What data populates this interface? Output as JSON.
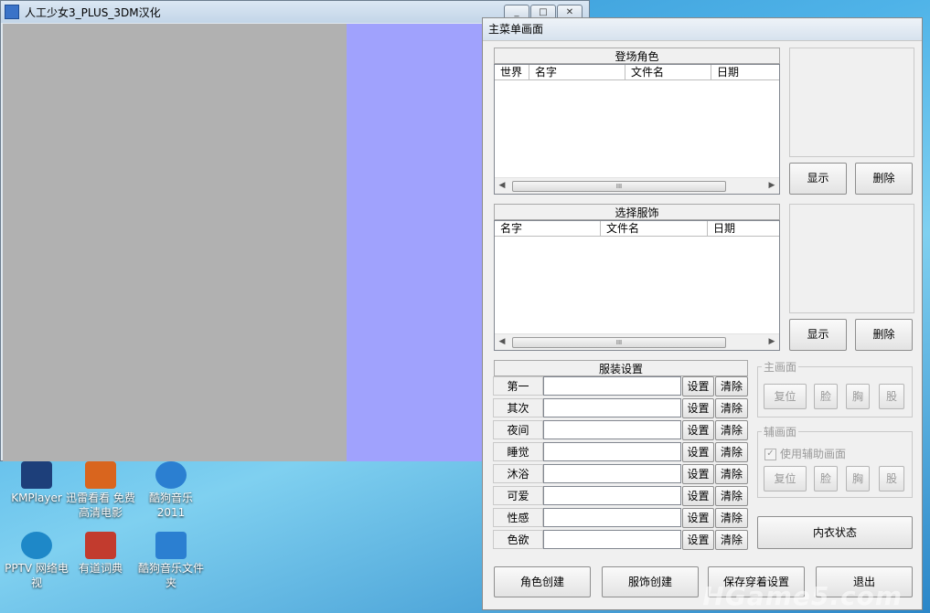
{
  "game_window": {
    "title": "人工少女3_PLUS_3DM汉化",
    "caption_buttons": [
      "_",
      "□",
      "✕"
    ]
  },
  "desktop_icons": [
    {
      "label": "KMPlayer",
      "color": "#1d3f7a"
    },
    {
      "label": "迅雷看看 免费高清电影",
      "color": "#d9651e"
    },
    {
      "label": "酷狗音乐 2011",
      "color": "#2b7fd1"
    },
    {
      "label": "PPTV 网络电视",
      "color": "#1e88c8"
    },
    {
      "label": "有道词典",
      "color": "#c23b2e"
    },
    {
      "label": "酷狗音乐文件夹",
      "color": "#2b7fd1"
    }
  ],
  "dialog": {
    "title": "主菜单画面",
    "characters": {
      "heading": "登场角色",
      "columns": [
        "世界",
        "名字",
        "文件名",
        "日期"
      ],
      "show_label": "显示",
      "delete_label": "删除"
    },
    "outfits": {
      "heading": "选择服饰",
      "columns": [
        "名字",
        "文件名",
        "日期"
      ],
      "show_label": "显示",
      "delete_label": "删除"
    },
    "costume_settings": {
      "heading": "服装设置",
      "rows": [
        {
          "label": "第一",
          "set": "设置",
          "clear": "清除"
        },
        {
          "label": "其次",
          "set": "设置",
          "clear": "清除"
        },
        {
          "label": "夜间",
          "set": "设置",
          "clear": "清除"
        },
        {
          "label": "睡觉",
          "set": "设置",
          "clear": "清除"
        },
        {
          "label": "沐浴",
          "set": "设置",
          "clear": "清除"
        },
        {
          "label": "可爱",
          "set": "设置",
          "clear": "清除"
        },
        {
          "label": "性感",
          "set": "设置",
          "clear": "清除"
        },
        {
          "label": "色欲",
          "set": "设置",
          "clear": "清除"
        }
      ]
    },
    "main_view": {
      "heading": "主画面",
      "buttons": [
        "复位",
        "脸",
        "胸",
        "股"
      ]
    },
    "sub_view": {
      "heading": "辅画面",
      "checkbox_label": "使用辅助画面",
      "checked": true,
      "buttons": [
        "复位",
        "脸",
        "胸",
        "股"
      ]
    },
    "underwear_button": "内衣状态",
    "bottom_buttons": [
      "角色创建",
      "服饰创建",
      "保存穿着设置",
      "退出"
    ],
    "scroll_grip": "III"
  },
  "watermark": "HGame5.com"
}
